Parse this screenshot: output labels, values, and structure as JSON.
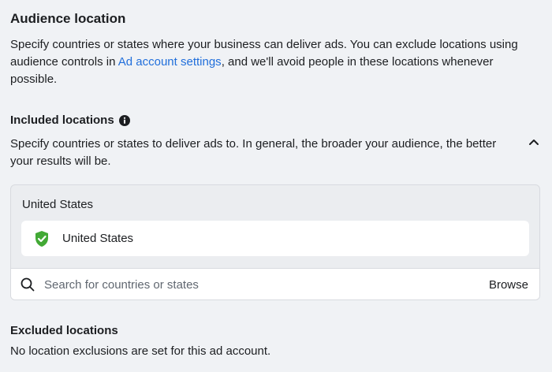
{
  "section": {
    "title": "Audience location",
    "desc_before": "Specify countries or states where your business can deliver ads. You can exclude locations using audience controls in ",
    "link_text": "Ad account settings",
    "desc_after": ", and we'll avoid people in these locations whenever possible."
  },
  "included": {
    "title": "Included locations",
    "info_icon": "info-circle-icon",
    "description": "Specify countries or states to deliver ads to. In general, the broader your audience, the better your results will be.",
    "collapse_icon": "chevron-up-icon",
    "group_label": "United States",
    "locations": [
      {
        "label": "United States",
        "icon": "shield-check-icon",
        "icon_color": "#42a935"
      }
    ],
    "search": {
      "placeholder": "Search for countries or states",
      "value": ""
    },
    "browse_label": "Browse"
  },
  "excluded": {
    "title": "Excluded locations",
    "description": "No location exclusions are set for this ad account."
  },
  "colors": {
    "link": "#216fdb",
    "background": "#f0f2f5",
    "box_background": "#ebedf0",
    "border": "#d8dadf",
    "text": "#1c1e21"
  }
}
